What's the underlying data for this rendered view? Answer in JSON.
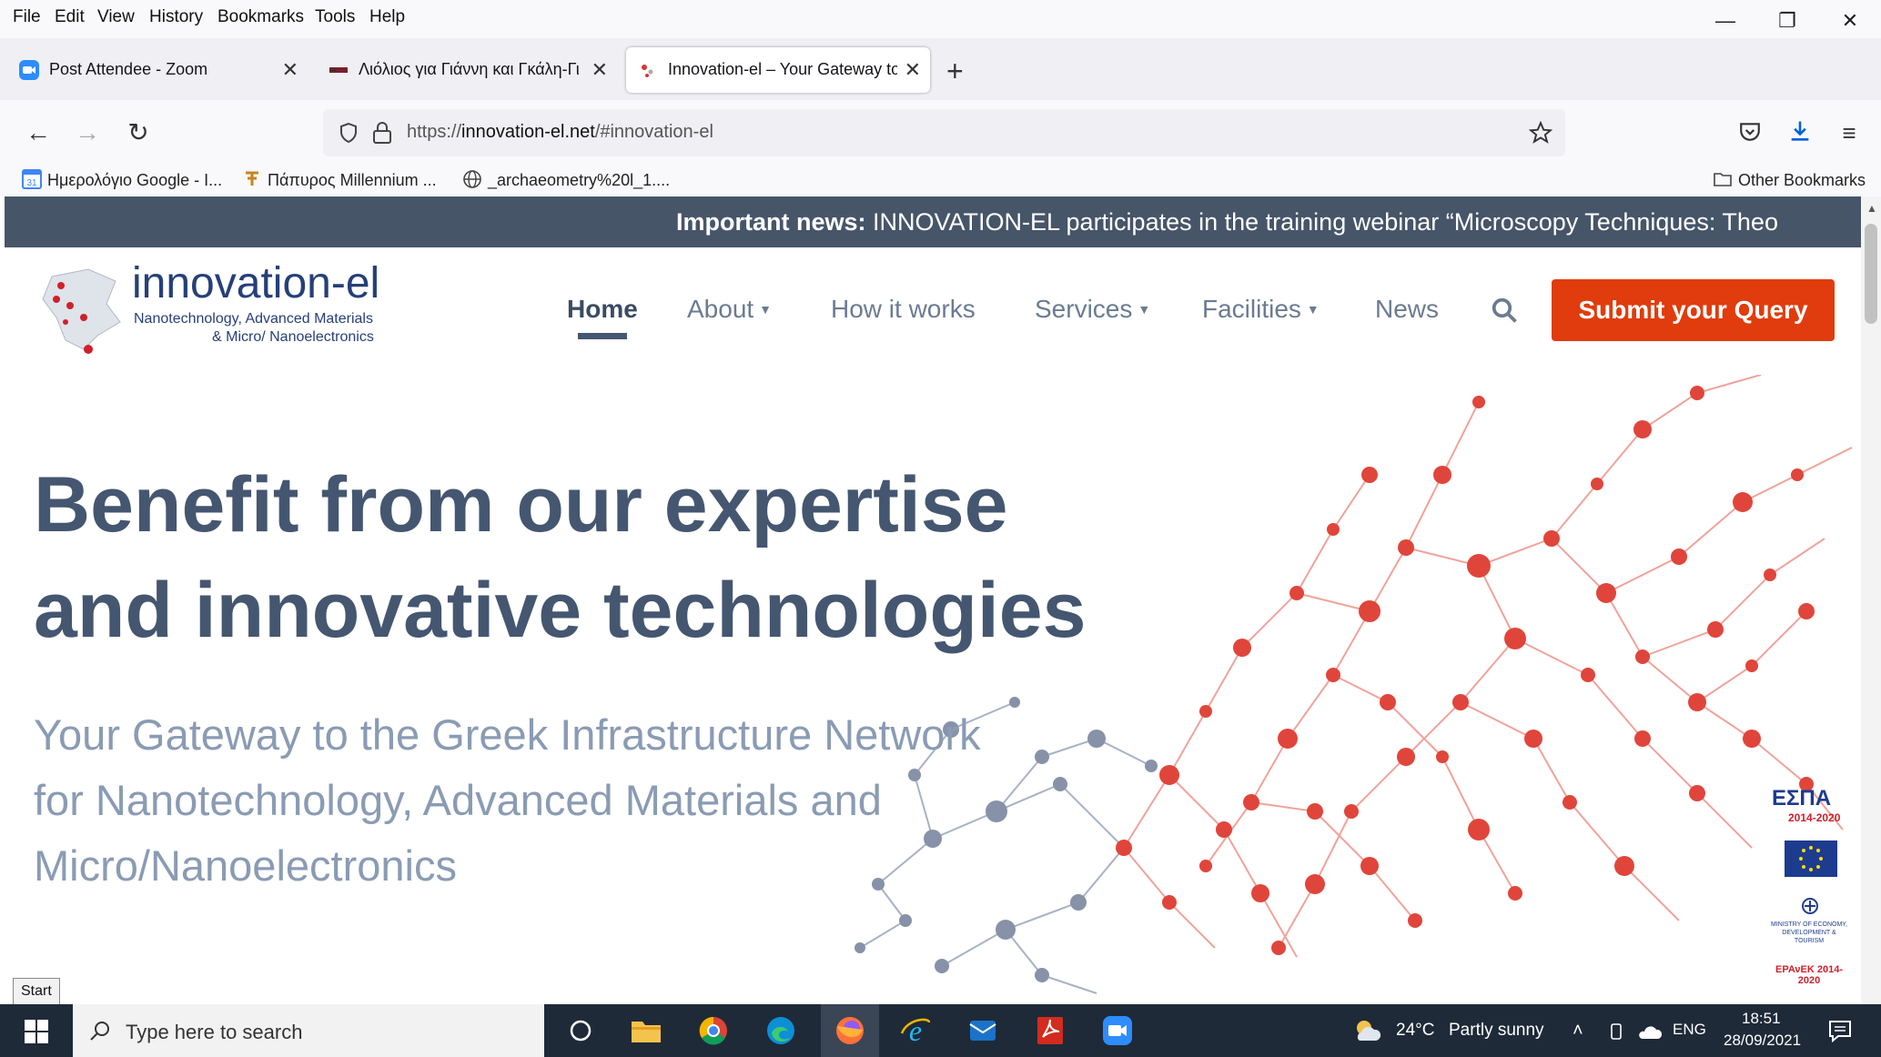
{
  "menubar": {
    "items": [
      "File",
      "Edit",
      "View",
      "History",
      "Bookmarks",
      "Tools",
      "Help"
    ]
  },
  "tabs": [
    {
      "label": "Post Attendee - Zoom"
    },
    {
      "label": "Λιόλιος για Γιάννη και Γκάλη-Γι"
    },
    {
      "label": "Innovation-el – Your Gateway to"
    }
  ],
  "url": {
    "prefix": "https://",
    "domain": "innovation-el.net",
    "path": "/#innovation-el"
  },
  "bookmarks": [
    {
      "label": "Ημερολόγιο Google - I..."
    },
    {
      "label": "Πάπυρος Millennium ..."
    },
    {
      "label": "_archaeometry%20l_1...."
    }
  ],
  "other_bookmarks": "Other Bookmarks",
  "news": {
    "label": "Important news:",
    "text": " INNOVATION-EL participates in the training webinar “Microscopy Techniques: Theo"
  },
  "logo": {
    "name": "innovation-el",
    "line1": "Nanotechnology, Advanced Materials",
    "line2": "& Micro/ Nanoelectronics"
  },
  "nav": {
    "home": "Home",
    "about": "About",
    "how": "How it works",
    "services": "Services",
    "facilities": "Facilities",
    "news": "News",
    "cta": "Submit your Query"
  },
  "hero": {
    "line1": "Benefit from our expertise",
    "line2": "and innovative technologies",
    "sub1": "Your Gateway to the Greek Infrastructure Network",
    "sub2": "for Nanotechnology, Advanced Materials and",
    "sub3": "Micro/Nanoelectronics"
  },
  "sponsors": {
    "espa": "ΕΣΠΑ",
    "espa_years": "2014-2020",
    "epanek": "ΕΡΑνΕΚ 2014-2020",
    "ministry": "MINISTRY OF ECONOMY, DEVELOPMENT & TOURISM"
  },
  "taskbar": {
    "search_placeholder": "Type here to search",
    "start_tooltip": "Start",
    "temperature": "24°C",
    "weather": "Partly sunny",
    "lang": "ENG",
    "time": "18:51",
    "date": "28/09/2021"
  },
  "colors": {
    "accent": "#e03c0d",
    "news_bg": "#475569",
    "heading": "#455670",
    "subheading": "#8a9bb4",
    "molecule_red": "#e0453b",
    "molecule_gray": "#8792a8"
  }
}
